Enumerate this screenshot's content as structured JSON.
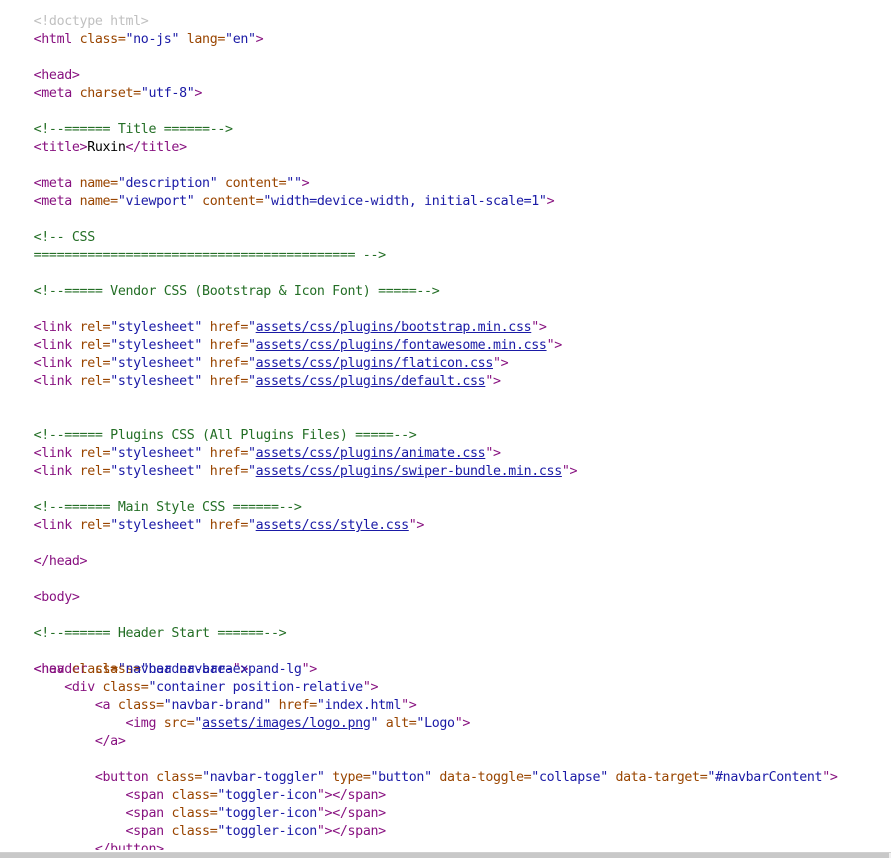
{
  "source": {
    "doctype": "<!doctype html>",
    "html_open": {
      "tag": "html",
      "class": "no-js",
      "lang": "en"
    },
    "head_open": "<head>",
    "meta_charset": "utf-8",
    "comment_title": "<!--====== Title ======-->",
    "title_text": "Ruxin",
    "meta_description": {
      "name": "description",
      "content": ""
    },
    "meta_viewport": {
      "name": "viewport",
      "content": "width=device-width, initial-scale=1"
    },
    "comment_css_1": "<!-- CSS",
    "comment_css_2": "========================================== -->",
    "comment_vendor": "<!--===== Vendor CSS (Bootstrap & Icon Font) =====-->",
    "vendor_links": [
      "assets/css/plugins/bootstrap.min.css",
      "assets/css/plugins/fontawesome.min.css",
      "assets/css/plugins/flaticon.css",
      "assets/css/plugins/default.css"
    ],
    "comment_plugins": "<!--===== Plugins CSS (All Plugins Files) =====-->",
    "plugin_links": [
      "assets/css/plugins/animate.css",
      "assets/css/plugins/swiper-bundle.min.css"
    ],
    "comment_main": "<!--====== Main Style CSS ======-->",
    "main_link": "assets/css/style.css",
    "head_close": "</head>",
    "body_open": "<body>",
    "comment_header": "<!--====== Header Start ======-->",
    "header_class": "header-area",
    "nav_class": "navbar navbar-expand-lg",
    "container_class": "container position-relative",
    "brand_class": "navbar-brand",
    "brand_href": "index.html",
    "logo_src": "assets/images/logo.png",
    "logo_alt": "Logo",
    "a_close": "</a>",
    "button": {
      "class": "navbar-toggler",
      "type": "button",
      "data_toggle": "collapse",
      "data_target": "#navbarContent"
    },
    "toggler_span_class": "toggler-icon",
    "button_close": "</button>",
    "str": {
      "rel": "rel=",
      "href": "href=",
      "class": "class=",
      "name": "name=",
      "content": "content=",
      "charset": "charset=",
      "lang": "lang=",
      "src": "src=",
      "alt": "alt=",
      "type": "type=",
      "data_toggle": "data-toggle=",
      "data_target": "data-target=",
      "stylesheet": "\"stylesheet\"",
      "link_open": "<link ",
      "meta_open": "<meta ",
      "close": "\">",
      "quote": "\"",
      "gt": ">",
      "title_open": "<title>",
      "title_close": "</title>",
      "header_open": "<header ",
      "nav_open": "<nav ",
      "div_open": "<div ",
      "a_open": "<a ",
      "img_open": "<img ",
      "button_open": "<button ",
      "span_open": "<span ",
      "span_close": "</span>",
      "html_open": "<html "
    }
  }
}
